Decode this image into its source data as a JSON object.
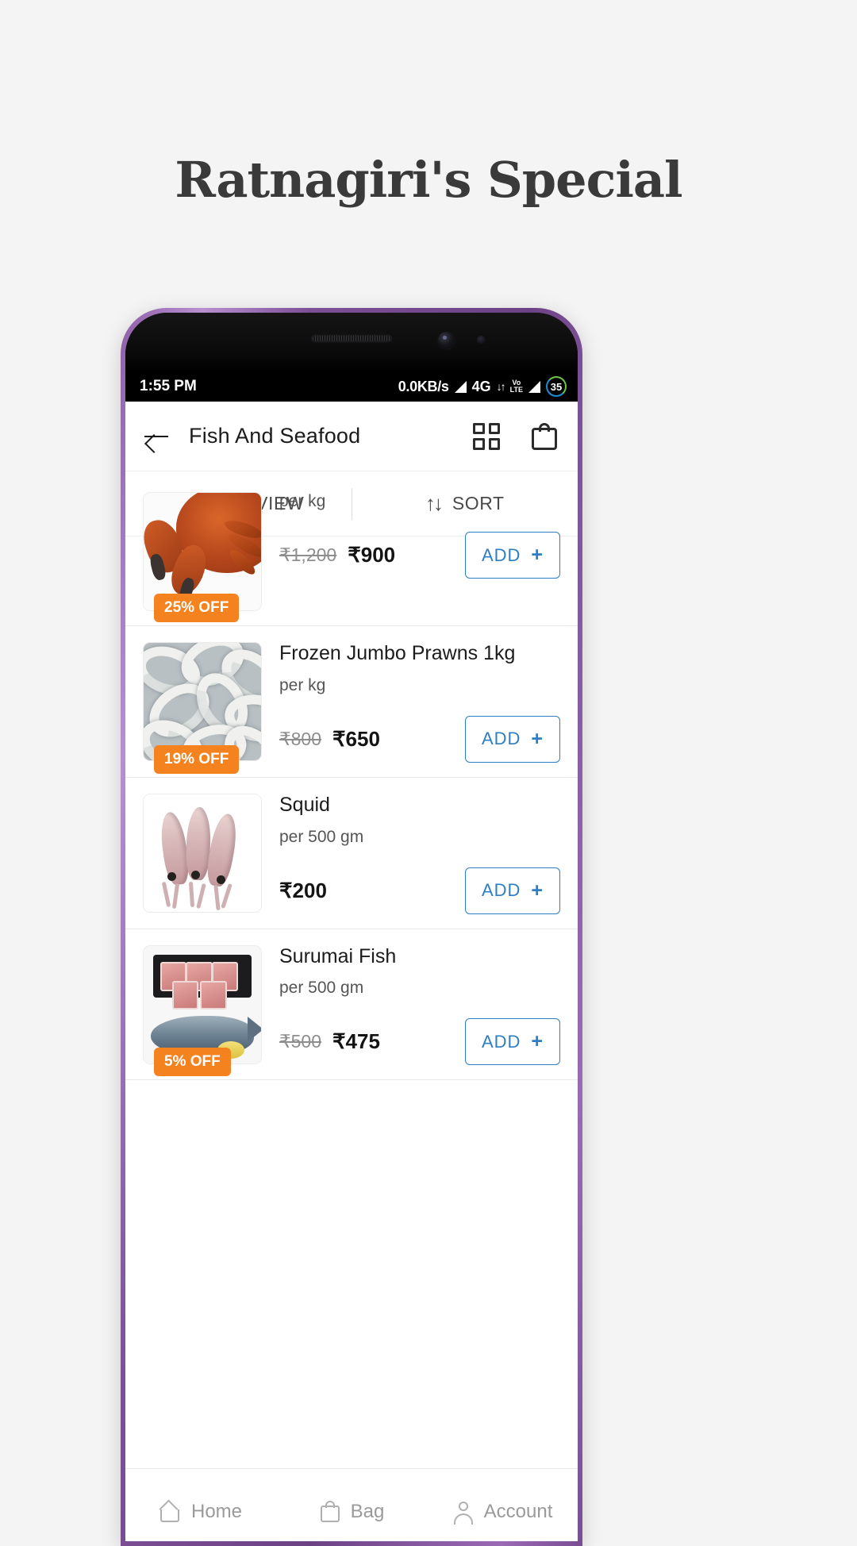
{
  "promo": {
    "headline": "Ratnagiri's Special"
  },
  "status_bar": {
    "time": "1:55 PM",
    "network_speed": "0.0KB/s",
    "network_type": "4G",
    "data_arrows": "↓↑",
    "volte_line1": "Vo",
    "volte_line2": "LTE",
    "battery_percent": "35"
  },
  "appbar": {
    "back_icon": "back-arrow-icon",
    "title": "Fish And Seafood",
    "grid_icon": "grid-icon",
    "bag_icon": "shopping-bag-icon"
  },
  "toolbar": {
    "grid_view_label": "GRID VIEW",
    "grid_view_icon": "grid-icon",
    "sort_label": "SORT",
    "sort_icon": "sort-arrows-icon"
  },
  "colors": {
    "accent_blue": "#2d7ec4",
    "badge_orange": "#f4821f",
    "page_background": "#f4f4f4",
    "phone_frame": "#7d4f96"
  },
  "products": [
    {
      "name": "",
      "unit": "per kg",
      "old_price": "₹1,200",
      "price": "₹900",
      "discount": "25% OFF",
      "add_label": "ADD",
      "add_plus": "+",
      "image": "crab-photo"
    },
    {
      "name": "Frozen Jumbo Prawns 1kg",
      "unit": "per kg",
      "old_price": "₹800",
      "price": "₹650",
      "discount": "19% OFF",
      "add_label": "ADD",
      "add_plus": "+",
      "image": "frozen-prawns-photo"
    },
    {
      "name": "Squid",
      "unit": "per 500 gm",
      "old_price": "",
      "price": "₹200",
      "discount": "",
      "add_label": "ADD",
      "add_plus": "+",
      "image": "squid-photo"
    },
    {
      "name": "Surumai Fish",
      "unit": "per 500 gm",
      "old_price": "₹500",
      "price": "₹475",
      "discount": "5% OFF",
      "add_label": "ADD",
      "add_plus": "+",
      "image": "surumai-fish-photo"
    }
  ],
  "bottom_nav": [
    {
      "label": "Home",
      "icon": "home-icon"
    },
    {
      "label": "Bag",
      "icon": "bag-icon"
    },
    {
      "label": "Account",
      "icon": "account-icon"
    }
  ]
}
